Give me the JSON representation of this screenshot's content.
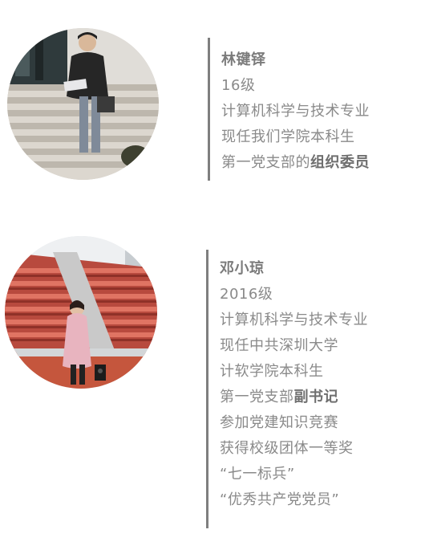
{
  "profiles": [
    {
      "name": "林键铎",
      "grade": "16级",
      "major": "计算机科学与技术专业",
      "role_line1": "现任我们学院本科生",
      "role_line2_prefix": "第一党支部的",
      "role_line2_bold": "组织委员"
    },
    {
      "name": "邓小琼",
      "grade": "2016级",
      "major": "计算机科学与技术专业",
      "role_line1": "现任中共深圳大学",
      "role_line2": "计软学院本科生",
      "role_line3_prefix": "第一党支部",
      "role_line3_bold": "副书记",
      "activity1": "参加党建知识竞赛",
      "activity2": "获得校级团体一等奖",
      "award1": "“七一标兵”",
      "award2": "“优秀共产党党员”"
    }
  ]
}
